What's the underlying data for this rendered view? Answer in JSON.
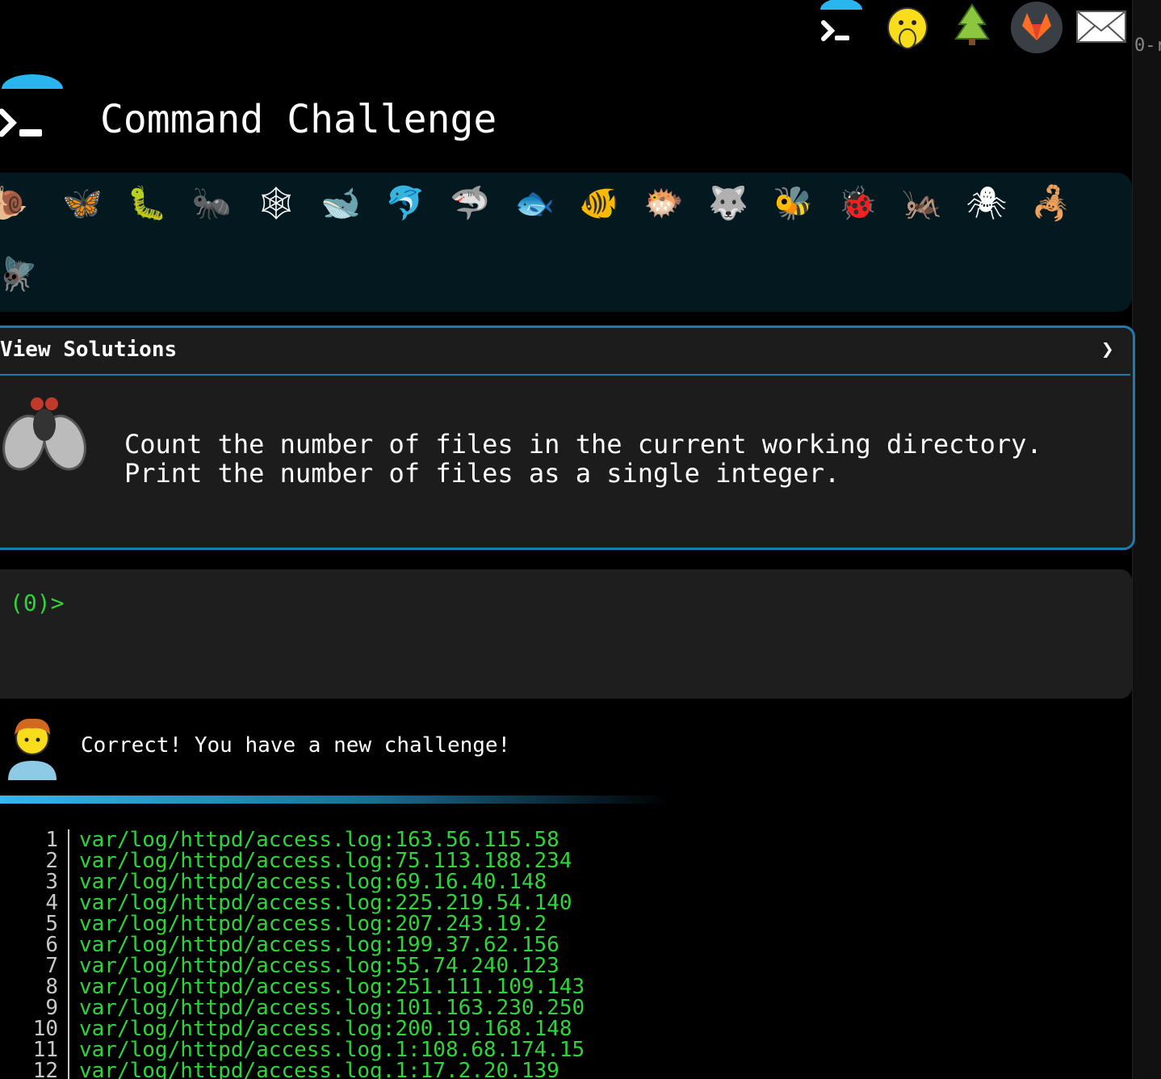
{
  "edge_text": "0-r",
  "top_icons": [
    "terminal-logo-icon",
    "face-hand-over-mouth-icon",
    "tree-icon",
    "gitlab-icon",
    "envelope-icon"
  ],
  "header": {
    "title": "Command Challenge"
  },
  "animals": [
    {
      "name": "snail-icon",
      "glyph": "🐌"
    },
    {
      "name": "butterfly-icon",
      "glyph": "🦋"
    },
    {
      "name": "caterpillar-icon",
      "glyph": "🐛"
    },
    {
      "name": "ant-icon",
      "glyph": "🐜"
    },
    {
      "name": "spider-web-icon",
      "glyph": "🕸"
    },
    {
      "name": "whale-icon",
      "glyph": "🐋"
    },
    {
      "name": "dolphin-icon",
      "glyph": "🐬"
    },
    {
      "name": "shark-icon",
      "glyph": "🦈"
    },
    {
      "name": "fish-icon",
      "glyph": "🐟"
    },
    {
      "name": "tropical-fish-icon",
      "glyph": "🐠"
    },
    {
      "name": "blowfish-icon",
      "glyph": "🐡"
    },
    {
      "name": "wolf-icon",
      "glyph": "🐺"
    },
    {
      "name": "bee-icon",
      "glyph": "🐝"
    },
    {
      "name": "ladybug-icon",
      "glyph": "🐞"
    },
    {
      "name": "cricket-icon",
      "glyph": "🦗"
    },
    {
      "name": "spider-icon",
      "glyph": "🕷"
    },
    {
      "name": "scorpion-icon",
      "glyph": "🦂"
    },
    {
      "name": "fly-icon",
      "glyph": "🪰"
    }
  ],
  "panel": {
    "heading": "View Solutions",
    "chevron": "❯",
    "challenge_icon": "fly-icon",
    "description": "Count the number of files in the current working directory.\nPrint the number of files as a single integer."
  },
  "terminal": {
    "prompt": "(0)>"
  },
  "message": {
    "avatar": "man-avatar-icon",
    "text": "Correct! You have a new challenge!"
  },
  "output_lines": [
    {
      "n": "1",
      "text": "var/log/httpd/access.log:163.56.115.58"
    },
    {
      "n": "2",
      "text": "var/log/httpd/access.log:75.113.188.234"
    },
    {
      "n": "3",
      "text": "var/log/httpd/access.log:69.16.40.148"
    },
    {
      "n": "4",
      "text": "var/log/httpd/access.log:225.219.54.140"
    },
    {
      "n": "5",
      "text": "var/log/httpd/access.log:207.243.19.2"
    },
    {
      "n": "6",
      "text": "var/log/httpd/access.log:199.37.62.156"
    },
    {
      "n": "7",
      "text": "var/log/httpd/access.log:55.74.240.123"
    },
    {
      "n": "8",
      "text": "var/log/httpd/access.log:251.111.109.143"
    },
    {
      "n": "9",
      "text": "var/log/httpd/access.log:101.163.230.250"
    },
    {
      "n": "10",
      "text": "var/log/httpd/access.log:200.19.168.148"
    },
    {
      "n": "11",
      "text": "var/log/httpd/access.log.1:108.68.174.15"
    },
    {
      "n": "12",
      "text": "var/log/httpd/access.log.1:17.2.20.139"
    }
  ]
}
